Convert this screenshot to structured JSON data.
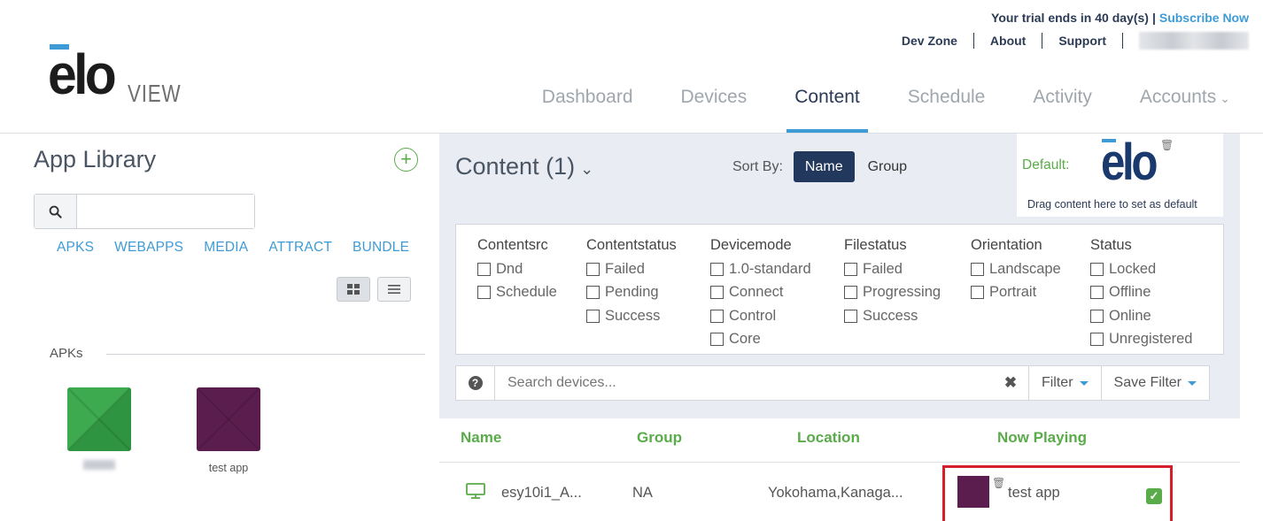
{
  "header": {
    "trial_text": "Your trial ends in 40 day(s)",
    "separator": "|",
    "subscribe_label": "Subscribe Now",
    "links": [
      "Dev Zone",
      "About",
      "Support"
    ],
    "logo_text": "elo",
    "logo_sub": "VIEW",
    "nav": [
      {
        "label": "Dashboard"
      },
      {
        "label": "Devices"
      },
      {
        "label": "Content",
        "active": true
      },
      {
        "label": "Schedule"
      },
      {
        "label": "Activity"
      },
      {
        "label": "Accounts"
      }
    ],
    "accounts_chevron": "⌄"
  },
  "app_library": {
    "title": "App Library",
    "add_icon": "plus-circle-icon",
    "search_value": "",
    "categories": [
      "APKS",
      "WEBAPPS",
      "MEDIA",
      "ATTRACT",
      "BUNDLE"
    ],
    "section_label": "APKs",
    "apps": [
      {
        "name": "",
        "color": "#3daa4f"
      },
      {
        "name": "test app",
        "color": "#5b1d4e"
      }
    ]
  },
  "content": {
    "title": "Content (1)",
    "chevron": "⌄",
    "sort_by_label": "Sort By:",
    "sort_options": [
      "Name",
      "Group"
    ],
    "sort_selected": "Name",
    "default_label": "Default:",
    "default_logo": "elo",
    "default_hint": "Drag content here to set as default",
    "filters": [
      {
        "heading": "Contentsrc",
        "options": [
          "Dnd",
          "Schedule"
        ]
      },
      {
        "heading": "Contentstatus",
        "options": [
          "Failed",
          "Pending",
          "Success"
        ]
      },
      {
        "heading": "Devicemode",
        "options": [
          "1.0-standard",
          "Connect",
          "Control",
          "Core"
        ]
      },
      {
        "heading": "Filestatus",
        "options": [
          "Failed",
          "Progressing",
          "Success"
        ]
      },
      {
        "heading": "Orientation",
        "options": [
          "Landscape",
          "Portrait"
        ]
      },
      {
        "heading": "Status",
        "options": [
          "Locked",
          "Offline",
          "Online",
          "Unregistered"
        ]
      }
    ],
    "search_placeholder": "Search devices...",
    "filter_button": "Filter",
    "save_filter_button": "Save Filter"
  },
  "table": {
    "columns": [
      "Name",
      "Group",
      "Location",
      "Now Playing"
    ],
    "rows": [
      {
        "name": "esy10i1_A...",
        "group": "NA",
        "location": "Yokohama,Kanaga...",
        "now_playing": "test app",
        "checked": true
      }
    ]
  },
  "colors": {
    "accent_blue": "#3e9bd6",
    "green": "#5aab4a",
    "navy": "#22385c",
    "highlight_red": "#d21f2a"
  }
}
